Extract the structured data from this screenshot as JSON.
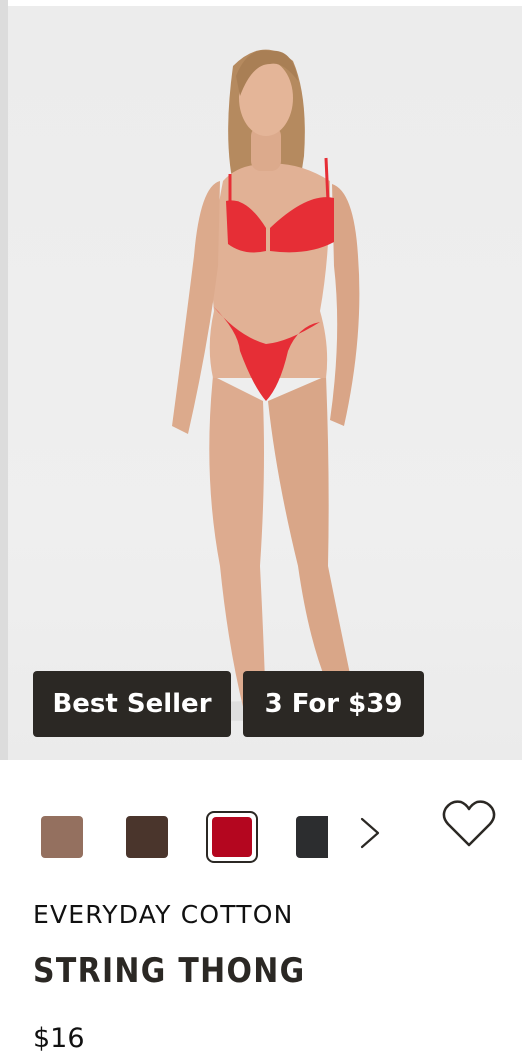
{
  "product": {
    "badges": [
      "Best Seller",
      "3 For $39"
    ],
    "collection": "EVERYDAY COTTON",
    "name": "STRING THONG",
    "price": "$16"
  },
  "swatches": [
    {
      "color": "#94705f",
      "selected": false
    },
    {
      "color": "#4a352c",
      "selected": false
    },
    {
      "color": "#b4061f",
      "selected": true
    },
    {
      "color": "#2c2d2f",
      "selected": false
    }
  ],
  "icons": {
    "next": "chevron-right-icon",
    "wishlist": "heart-icon"
  },
  "colors": {
    "badge_bg": "#2b2824",
    "badge_text": "#ffffff",
    "image_bg": "#ececec",
    "product_red": "#e62e36"
  }
}
